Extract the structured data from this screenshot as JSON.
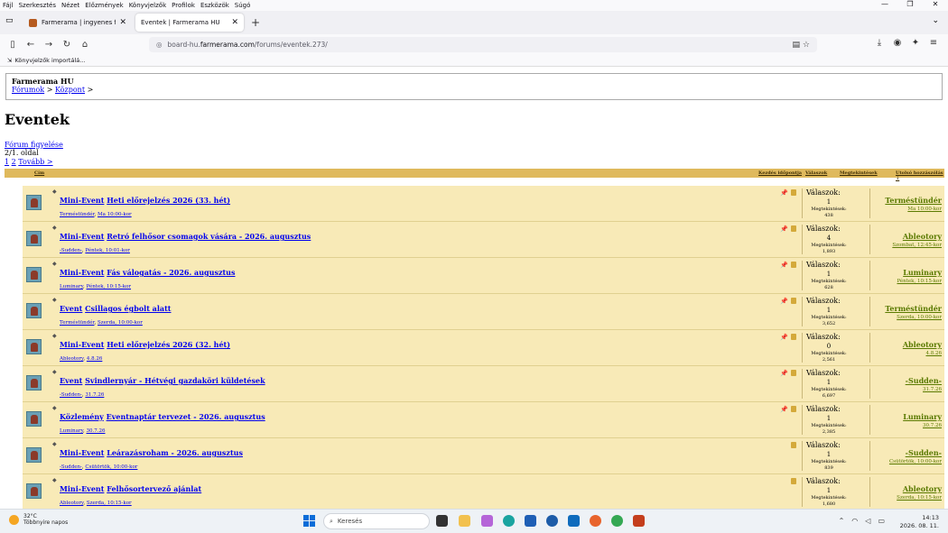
{
  "menu": [
    "Fájl",
    "Szerkesztés",
    "Nézet",
    "Előzmények",
    "Könyvjelzők",
    "Profilok",
    "Eszközök",
    "Súgó"
  ],
  "tabs": [
    {
      "title": "Farmerama | ingyenes farmos já",
      "active": false
    },
    {
      "title": "Eventek | Farmerama HU",
      "active": true
    }
  ],
  "url": {
    "prefix": "board-hu.",
    "domain": "farmerama.com",
    "path": "/forums/eventek.273/"
  },
  "bookmarks": {
    "import": "Könyvjelzők importálá..."
  },
  "crumb": {
    "site": "Farmerama HU",
    "l1": "Fórumok",
    "sep": " > ",
    "l2": "Központ",
    "end": " >"
  },
  "page_title": "Eventek",
  "follow": "Fórum figyelése",
  "pages": {
    "text": "2/1. oldal",
    "p1": "1",
    "p2": "2",
    "next": "Tovább >"
  },
  "header": {
    "title": "Cím",
    "start": "Kezdés időpontja",
    "replies": "Válaszok",
    "views": "Megtekintések",
    "last": "Utolsó hozzászólás ↓"
  },
  "labels": {
    "replies": "Válaszok:",
    "views": "Megtekintések:"
  },
  "threads": [
    {
      "prefix": "Mini-Event",
      "title": "Heti előrejelzés 2026 (33. hét)",
      "author": "Terméstündér",
      "date": "Ma 10:00-kor",
      "replies": "1",
      "views": "438",
      "lp_user": "Terméstündér",
      "lp_time": "Ma 10:00-kor",
      "pinned": true
    },
    {
      "prefix": "Mini-Event",
      "title": "Retró felhősor csomagok vására - 2026. augusztus",
      "author": "-Sudden-",
      "date": "Péntek, 10:01-kor",
      "replies": "4",
      "views": "1,893",
      "lp_user": "Ableotory",
      "lp_time": "Szombat, 12:45-kor",
      "pinned": true
    },
    {
      "prefix": "Mini-Event",
      "title": "Fás válogatás - 2026. augusztus",
      "author": "Luminary",
      "date": "Péntek, 10:15-kor",
      "replies": "1",
      "views": "628",
      "lp_user": "Luminary",
      "lp_time": "Péntek, 10:15-kor",
      "pinned": true
    },
    {
      "prefix": "Event",
      "title": "Csillagos égbolt alatt",
      "author": "Terméstündér",
      "date": "Szerda, 10:00-kor",
      "replies": "1",
      "views": "3,652",
      "lp_user": "Terméstündér",
      "lp_time": "Szerda, 10:00-kor",
      "pinned": true
    },
    {
      "prefix": "Mini-Event",
      "title": "Heti előrejelzés 2026 (32. hét)",
      "author": "Ableotory",
      "date": "4.8.26",
      "replies": "0",
      "views": "2,561",
      "lp_user": "Ableotory",
      "lp_time": "4.8.26",
      "pinned": true
    },
    {
      "prefix": "Event",
      "title": "Svindlernyár - Hétvégi gazdaköri küldetések",
      "author": "-Sudden-",
      "date": "31.7.26",
      "replies": "1",
      "views": "6,697",
      "lp_user": "-Sudden-",
      "lp_time": "31.7.26",
      "pinned": true
    },
    {
      "prefix": "Közlemény",
      "title": "Eventnaptár tervezet - 2026. augusztus",
      "author": "Luminary",
      "date": "30.7.26",
      "replies": "1",
      "views": "2,385",
      "lp_user": "Luminary",
      "lp_time": "30.7.26",
      "pinned": true
    },
    {
      "prefix": "Mini-Event",
      "title": "Leárazásroham - 2026. augusztus",
      "author": "-Sudden-",
      "date": "Csütörtök, 10:00-kor",
      "replies": "1",
      "views": "839",
      "lp_user": "-Sudden-",
      "lp_time": "Csütörtök, 10:00-kor",
      "pinned": false
    },
    {
      "prefix": "Mini-Event",
      "title": "Felhősortervező ajánlat",
      "author": "Ableotory",
      "date": "Szerda, 10:15-kor",
      "replies": "1",
      "views": "1,680",
      "lp_user": "Ableotory",
      "lp_time": "Szerda, 10:15-kor",
      "pinned": false
    }
  ],
  "taskbar": {
    "temp": "32°C",
    "weather": "Többnyire napos",
    "search": "Keresés",
    "time": "14:13",
    "date": "2026. 08. 11."
  }
}
